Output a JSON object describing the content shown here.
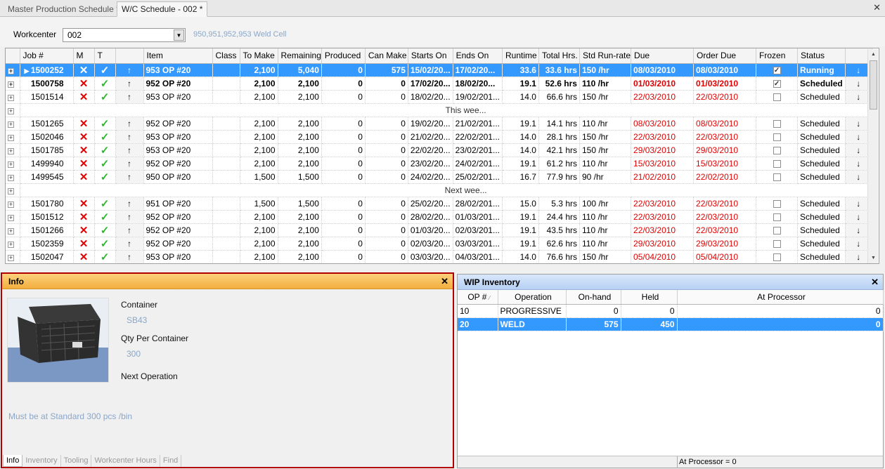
{
  "tabs": [
    {
      "label": "Master Production Schedule *",
      "active": false
    },
    {
      "label": "W/C Schedule - 002 *",
      "active": true
    }
  ],
  "workcenter": {
    "label": "Workcenter",
    "value": "002",
    "description": "950,951,952,953 Weld Cell"
  },
  "grid": {
    "columns": [
      "Job #",
      "M",
      "T",
      "",
      "Item",
      "Class",
      "To Make",
      "Remaining",
      "Produced",
      "Can Make",
      "Starts On",
      "Ends On",
      "Runtime",
      "Total Hrs.",
      "Std Run-rate",
      "Due",
      "Order Due",
      "Frozen",
      "Status",
      ""
    ],
    "rows": [
      {
        "kind": "row",
        "style": "sel",
        "current": true,
        "job": "1500252",
        "item": "953 OP #20",
        "to_make": "2,100",
        "remaining": "5,040",
        "produced": "0",
        "can_make": "575",
        "starts": "15/02/20...",
        "ends": "17/02/20...",
        "runtime": "33.6",
        "total": "33.6 hrs",
        "rate": "150 /hr",
        "due": "08/03/2010",
        "order_due": "08/03/2010",
        "red": false,
        "frozen": true,
        "status": "Running"
      },
      {
        "kind": "row",
        "style": "bold",
        "job": "1500758",
        "item": "952 OP #20",
        "to_make": "2,100",
        "remaining": "2,100",
        "produced": "0",
        "can_make": "0",
        "starts": "17/02/20...",
        "ends": "18/02/20...",
        "runtime": "19.1",
        "total": "52.6 hrs",
        "rate": "110 /hr",
        "due": "01/03/2010",
        "order_due": "01/03/2010",
        "red": true,
        "frozen": true,
        "status": "Scheduled"
      },
      {
        "kind": "row",
        "job": "1501514",
        "item": "953 OP #20",
        "to_make": "2,100",
        "remaining": "2,100",
        "produced": "0",
        "can_make": "0",
        "starts": "18/02/20...",
        "ends": "19/02/201...",
        "runtime": "14.0",
        "total": "66.6 hrs",
        "rate": "150 /hr",
        "due": "22/03/2010",
        "order_due": "22/03/2010",
        "red": true,
        "frozen": false,
        "status": "Scheduled"
      },
      {
        "kind": "group",
        "text": "This wee..."
      },
      {
        "kind": "row",
        "job": "1501265",
        "item": "952 OP #20",
        "to_make": "2,100",
        "remaining": "2,100",
        "produced": "0",
        "can_make": "0",
        "starts": "19/02/20...",
        "ends": "21/02/201...",
        "runtime": "19.1",
        "total": "14.1 hrs",
        "rate": "110 /hr",
        "due": "08/03/2010",
        "order_due": "08/03/2010",
        "red": true,
        "frozen": false,
        "status": "Scheduled"
      },
      {
        "kind": "row",
        "job": "1502046",
        "item": "953 OP #20",
        "to_make": "2,100",
        "remaining": "2,100",
        "produced": "0",
        "can_make": "0",
        "starts": "21/02/20...",
        "ends": "22/02/201...",
        "runtime": "14.0",
        "total": "28.1 hrs",
        "rate": "150 /hr",
        "due": "22/03/2010",
        "order_due": "22/03/2010",
        "red": true,
        "frozen": false,
        "status": "Scheduled"
      },
      {
        "kind": "row",
        "job": "1501785",
        "item": "953 OP #20",
        "to_make": "2,100",
        "remaining": "2,100",
        "produced": "0",
        "can_make": "0",
        "starts": "22/02/20...",
        "ends": "23/02/201...",
        "runtime": "14.0",
        "total": "42.1 hrs",
        "rate": "150 /hr",
        "due": "29/03/2010",
        "order_due": "29/03/2010",
        "red": true,
        "frozen": false,
        "status": "Scheduled"
      },
      {
        "kind": "row",
        "job": "1499940",
        "item": "952 OP #20",
        "to_make": "2,100",
        "remaining": "2,100",
        "produced": "0",
        "can_make": "0",
        "starts": "23/02/20...",
        "ends": "24/02/201...",
        "runtime": "19.1",
        "total": "61.2 hrs",
        "rate": "110 /hr",
        "due": "15/03/2010",
        "order_due": "15/03/2010",
        "red": true,
        "frozen": false,
        "status": "Scheduled"
      },
      {
        "kind": "row",
        "job": "1499545",
        "item": "950 OP #20",
        "to_make": "1,500",
        "remaining": "1,500",
        "produced": "0",
        "can_make": "0",
        "starts": "24/02/20...",
        "ends": "25/02/201...",
        "runtime": "16.7",
        "total": "77.9 hrs",
        "rate": "90 /hr",
        "due": "21/02/2010",
        "order_due": "22/02/2010",
        "red": true,
        "frozen": false,
        "status": "Scheduled"
      },
      {
        "kind": "group",
        "text": "Next wee..."
      },
      {
        "kind": "row",
        "job": "1501780",
        "item": "951 OP #20",
        "to_make": "1,500",
        "remaining": "1,500",
        "produced": "0",
        "can_make": "0",
        "starts": "25/02/20...",
        "ends": "28/02/201...",
        "runtime": "15.0",
        "total": "5.3 hrs",
        "rate": "100 /hr",
        "due": "22/03/2010",
        "order_due": "22/03/2010",
        "red": true,
        "frozen": false,
        "status": "Scheduled"
      },
      {
        "kind": "row",
        "job": "1501512",
        "item": "952 OP #20",
        "to_make": "2,100",
        "remaining": "2,100",
        "produced": "0",
        "can_make": "0",
        "starts": "28/02/20...",
        "ends": "01/03/201...",
        "runtime": "19.1",
        "total": "24.4 hrs",
        "rate": "110 /hr",
        "due": "22/03/2010",
        "order_due": "22/03/2010",
        "red": true,
        "frozen": false,
        "status": "Scheduled"
      },
      {
        "kind": "row",
        "job": "1501266",
        "item": "952 OP #20",
        "to_make": "2,100",
        "remaining": "2,100",
        "produced": "0",
        "can_make": "0",
        "starts": "01/03/20...",
        "ends": "02/03/201...",
        "runtime": "19.1",
        "total": "43.5 hrs",
        "rate": "110 /hr",
        "due": "22/03/2010",
        "order_due": "22/03/2010",
        "red": true,
        "frozen": false,
        "status": "Scheduled"
      },
      {
        "kind": "row",
        "job": "1502359",
        "item": "952 OP #20",
        "to_make": "2,100",
        "remaining": "2,100",
        "produced": "0",
        "can_make": "0",
        "starts": "02/03/20...",
        "ends": "03/03/201...",
        "runtime": "19.1",
        "total": "62.6 hrs",
        "rate": "110 /hr",
        "due": "29/03/2010",
        "order_due": "29/03/2010",
        "red": true,
        "frozen": false,
        "status": "Scheduled"
      },
      {
        "kind": "row",
        "job": "1502047",
        "item": "953 OP #20",
        "to_make": "2,100",
        "remaining": "2,100",
        "produced": "0",
        "can_make": "0",
        "starts": "03/03/20...",
        "ends": "04/03/201...",
        "runtime": "14.0",
        "total": "76.6 hrs",
        "rate": "150 /hr",
        "due": "05/04/2010",
        "order_due": "05/04/2010",
        "red": true,
        "frozen": false,
        "status": "Scheduled"
      }
    ]
  },
  "info": {
    "title": "Info",
    "container_label": "Container",
    "container_value": "SB43",
    "qty_label": "Qty Per Container",
    "qty_value": "300",
    "next_op_label": "Next Operation",
    "note": "Must be at Standard 300 pcs /bin",
    "bottom_tabs": [
      "Info",
      "Inventory",
      "Tooling",
      "Workcenter Hours",
      "Find"
    ]
  },
  "wip": {
    "title": "WIP Inventory",
    "columns": [
      "OP #",
      "Operation",
      "On-hand",
      "Held",
      "At Processor"
    ],
    "rows": [
      {
        "op": "10",
        "operation": "PROGRESSIVE",
        "onhand": "0",
        "held": "0",
        "atproc": "0",
        "selected": false
      },
      {
        "op": "20",
        "operation": "WELD",
        "onhand": "575",
        "held": "450",
        "atproc": "0",
        "selected": true
      }
    ],
    "footer": "At Processor = 0"
  },
  "colors": {
    "selection": "#3399ff",
    "overdue": "#e00000",
    "info_header": "#f3ae3e",
    "wip_header": "#b7d0f3"
  },
  "icons": {
    "m_flag": "red-x-icon",
    "t_flag": "green-check-icon",
    "move_up": "up-arrow-icon",
    "move_down": "down-arrow-icon"
  }
}
